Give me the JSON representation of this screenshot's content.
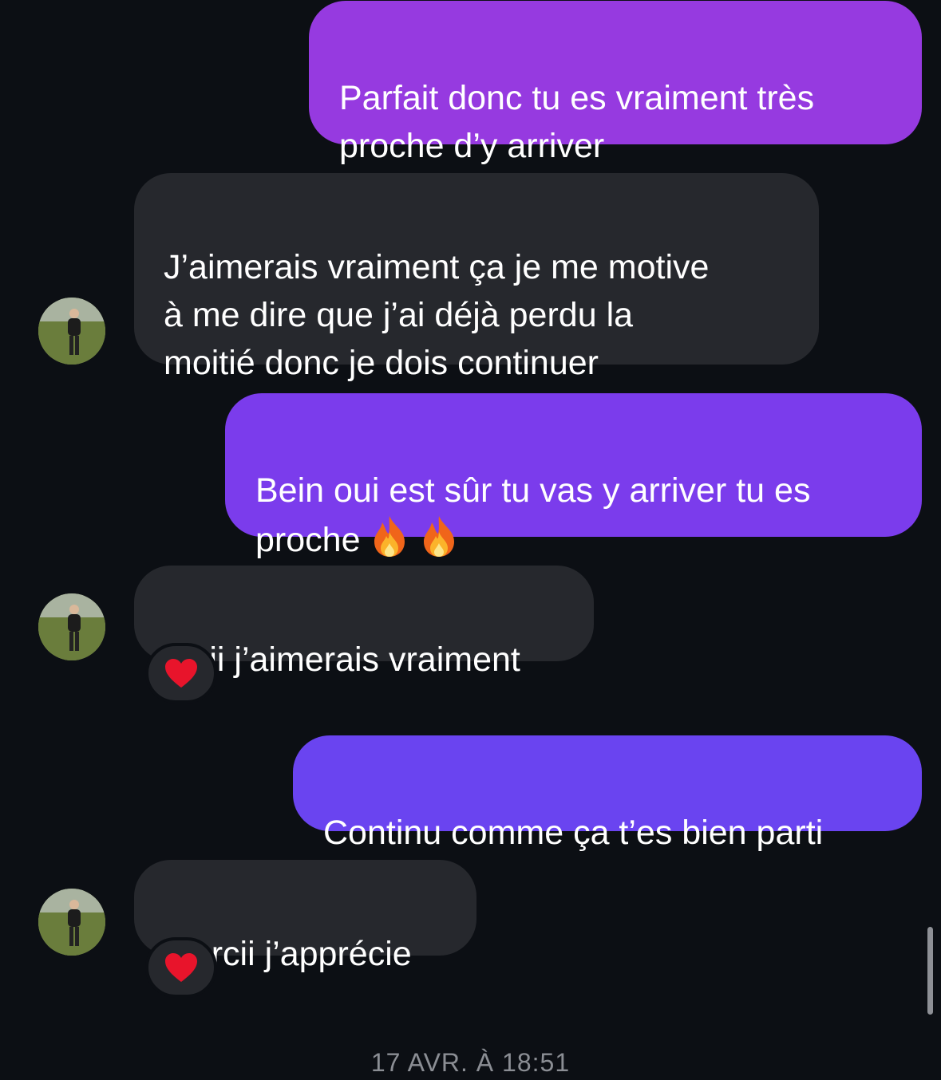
{
  "colors": {
    "background": "#0c0f14",
    "received_bubble": "#26282d",
    "sent_bubble_1": "#963ae0",
    "sent_bubble_2": "#7b3cec",
    "sent_bubble_3": "#6a44f0",
    "timestamp_text": "#8b8e94"
  },
  "messages": [
    {
      "direction": "sent",
      "text": "Parfait donc tu es vraiment très\nproche d’y arriver"
    },
    {
      "direction": "received",
      "text": "J’aimerais vraiment ça je me motive\nà me dire que j’ai déjà perdu la\nmoitié donc je dois continuer",
      "avatar": "profile-photo"
    },
    {
      "direction": "sent",
      "text": "Bein oui est sûr tu vas y arriver tu es\nproche",
      "emojis": [
        "fire-icon",
        "fire-icon"
      ]
    },
    {
      "direction": "received",
      "text": "Ouii j’aimerais vraiment",
      "avatar": "profile-photo",
      "reaction": "heart-icon"
    },
    {
      "direction": "sent",
      "text": "Continu comme ça t’es bien parti"
    },
    {
      "direction": "received",
      "text": "Mercii j’apprécie",
      "avatar": "profile-photo",
      "reaction": "heart-icon"
    }
  ],
  "timestamp": "17 AVR. À 18:51"
}
